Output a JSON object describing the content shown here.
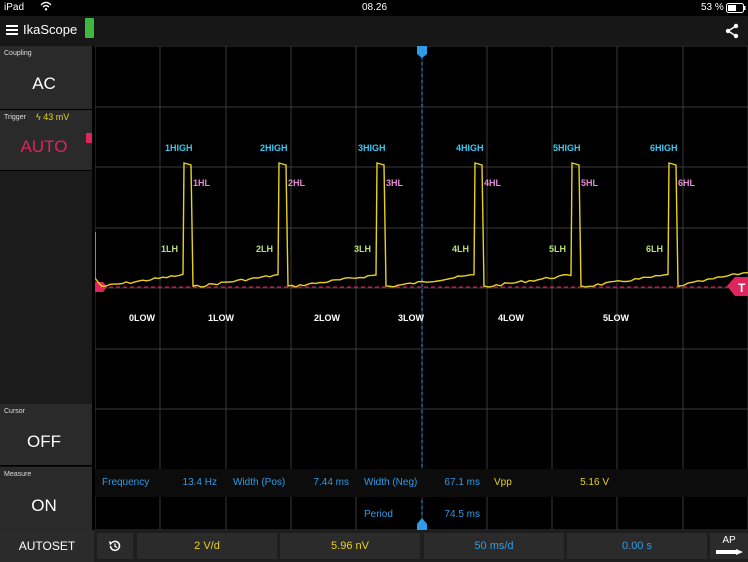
{
  "status": {
    "device": "iPad",
    "time": "08.26",
    "battery": "53 %"
  },
  "app": {
    "title": "IkaScope"
  },
  "sidebar": {
    "coupling": {
      "label": "Coupling",
      "value": "AC"
    },
    "trigger": {
      "label": "Trigger",
      "level": "43 mV",
      "value": "AUTO"
    },
    "cursor": {
      "label": "Cursor",
      "value": "OFF"
    },
    "measure": {
      "label": "Measure",
      "value": "ON"
    }
  },
  "markers": {
    "low": [
      "0LOW",
      "1LOW",
      "2LOW",
      "3LOW",
      "4LOW",
      "5LOW"
    ],
    "lh": [
      "1LH",
      "2LH",
      "3LH",
      "4LH",
      "5LH",
      "6LH"
    ],
    "high": [
      "1HIGH",
      "2HIGH",
      "3HIGH",
      "4HIGH",
      "5HIGH",
      "6HIGH"
    ],
    "hl": [
      "1HL",
      "2HL",
      "3HL",
      "4HL",
      "5HL",
      "6HL"
    ],
    "trigger_tag": "T"
  },
  "measurements": {
    "frequency_label": "Frequency",
    "frequency_value": "13.4 Hz",
    "width_pos_label": "Width (Pos)",
    "width_pos_value": "7.44 ms",
    "width_neg_label": "Width (Neg)",
    "width_neg_value": "67.1 ms",
    "vpp_label": "Vpp",
    "vpp_value": "5.16 V",
    "period_label": "Period",
    "period_value": "74.5 ms"
  },
  "bottom": {
    "autoset": "AUTOSET",
    "volts_div": "2 V/d",
    "offset": "5.96 nV",
    "time_div": "50 ms/d",
    "time_offset": "0.00 s",
    "ap": "AP"
  },
  "colors": {
    "trace": "#e8d21e",
    "accent_blue": "#2f9be6",
    "trigger_red": "#e0245e",
    "high": "#3cc8f0",
    "hl": "#e58ad6",
    "lh": "#b8e07a"
  }
}
